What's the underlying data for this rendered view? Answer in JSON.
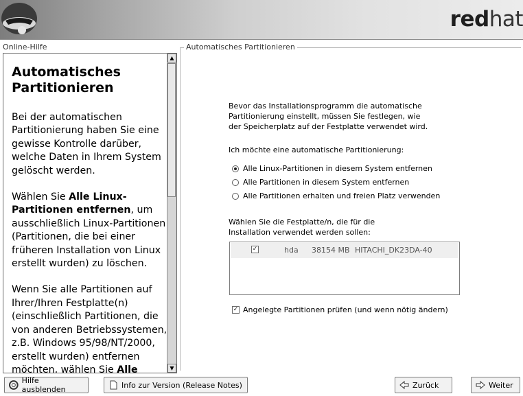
{
  "header": {
    "brand_bold": "red",
    "brand_light": "hat"
  },
  "help": {
    "panel_label": "Online-Hilfe",
    "heading_line1": "Automatisches",
    "heading_line2": "Partitionieren",
    "para1": "Bei der automatischen Partitionierung haben Sie eine gewisse Kontrolle darüber, welche Daten in Ihrem System gelöscht werden.",
    "para2_pre": "Wählen Sie ",
    "para2_bold": "Alle Linux-Partitionen entfernen",
    "para2_post": ", um ausschließlich Linux-Partitionen (Partitionen, die bei einer früheren Installation von Linux erstellt wurden) zu löschen.",
    "para3_pre": "Wenn Sie alle Partitionen auf Ihrer/Ihren Festplatte(n) (einschließlich Partitionen, die von anderen Betriebssystemen, z.B. Windows 95/98/NT/2000, erstellt wurden) entfernen möchten, wählen Sie ",
    "para3_bold": "Alle"
  },
  "main": {
    "frame_label": "Automatisches Partitionieren",
    "intro_line1": "Bevor das Installationsprogramm die automatische",
    "intro_line2": "Partitionierung einstellt, müssen Sie festlegen, wie",
    "intro_line3": "der Speicherplatz auf der Festplatte verwendet wird.",
    "question": "Ich möchte eine automatische Partitionierung:",
    "options": [
      {
        "label": "Alle Linux-Partitionen in diesem System entfernen",
        "selected": true
      },
      {
        "label": "Alle Partitionen in diesem System entfernen",
        "selected": false
      },
      {
        "label": "Alle Partitionen erhalten und freien Platz verwenden",
        "selected": false
      }
    ],
    "drive_label_line1": "Wählen Sie die Festplatte/n, die für die",
    "drive_label_line2": "Installation verwendet werden sollen:",
    "drives": [
      {
        "checked": true,
        "name": "hda",
        "size": "38154 MB",
        "model": "HITACHI_DK23DA-40"
      }
    ],
    "review_checkbox": {
      "checked": true,
      "label": "Angelegte Partitionen prüfen (und wenn nötig ändern)"
    }
  },
  "buttons": {
    "hide_help": "Hilfe ausblenden",
    "release_notes": "Info zur Version (Release Notes)",
    "back": "Zurück",
    "next": "Weiter"
  }
}
